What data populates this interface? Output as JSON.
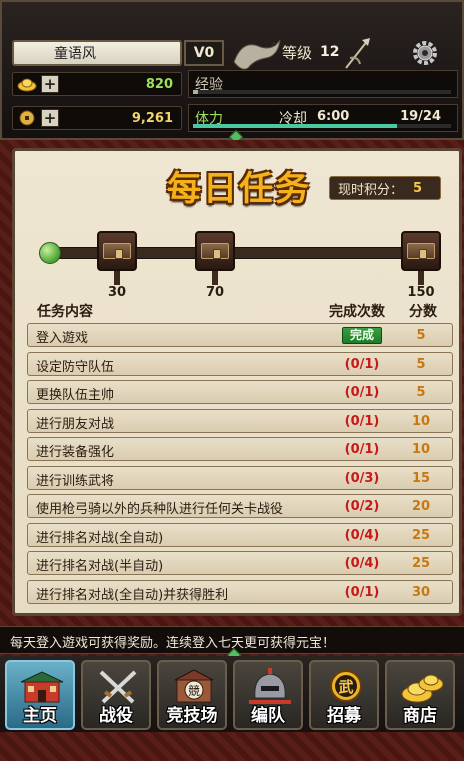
{
  "player": {
    "name": "童语风",
    "vip": "V0",
    "level_label": "等级",
    "level": "12"
  },
  "resources": {
    "gold": "820",
    "coins": "9,261",
    "add_symbol": "+"
  },
  "exp": {
    "label": "经验",
    "progress": 0.02
  },
  "stamina": {
    "label": "体力",
    "cooldown_label": "冷却",
    "cooldown": "6:00",
    "value": "19/24",
    "progress": 0.79
  },
  "panel": {
    "title": "每日任务",
    "score_label": "现时积分：",
    "score": "5",
    "milestones": [
      "30",
      "70",
      "150"
    ],
    "headers": {
      "task": "任务内容",
      "progress": "完成次数",
      "points": "分数"
    },
    "tasks": [
      {
        "name": "登入遊戏",
        "progress": "完成",
        "points": "5"
      },
      {
        "name": "设定防守队伍",
        "progress": "(0/1)",
        "points": "5"
      },
      {
        "name": "更换队伍主帅",
        "progress": "(0/1)",
        "points": "5"
      },
      {
        "name": "进行朋友对战",
        "progress": "(0/1)",
        "points": "10"
      },
      {
        "name": "进行装备强化",
        "progress": "(0/1)",
        "points": "10"
      },
      {
        "name": "进行训练武将",
        "progress": "(0/3)",
        "points": "15"
      },
      {
        "name": "使用枪弓骑以外的兵种队进行任何关卡战役",
        "progress": "(0/2)",
        "points": "20"
      },
      {
        "name": "进行排名对战(全自动)",
        "progress": "(0/4)",
        "points": "25"
      },
      {
        "name": "进行排名对战(半自动)",
        "progress": "(0/4)",
        "points": "25"
      },
      {
        "name": "进行排名对战(全自动)并获得胜利",
        "progress": "(0/1)",
        "points": "30"
      }
    ]
  },
  "notice": "每天登入遊戏可获得奖励。连续登入七天更可获得元宝！",
  "nav": {
    "items": [
      {
        "label": "主页",
        "icon": "palace-icon"
      },
      {
        "label": "战役",
        "icon": "crossed-swords-icon"
      },
      {
        "label": "竞技场",
        "icon": "arena-icon"
      },
      {
        "label": "编队",
        "icon": "helmet-icon"
      },
      {
        "label": "招募",
        "icon": "recruit-coin-icon"
      },
      {
        "label": "商店",
        "icon": "gold-ingot-icon"
      }
    ],
    "badge_text": "武",
    "arena_badge": "競"
  }
}
